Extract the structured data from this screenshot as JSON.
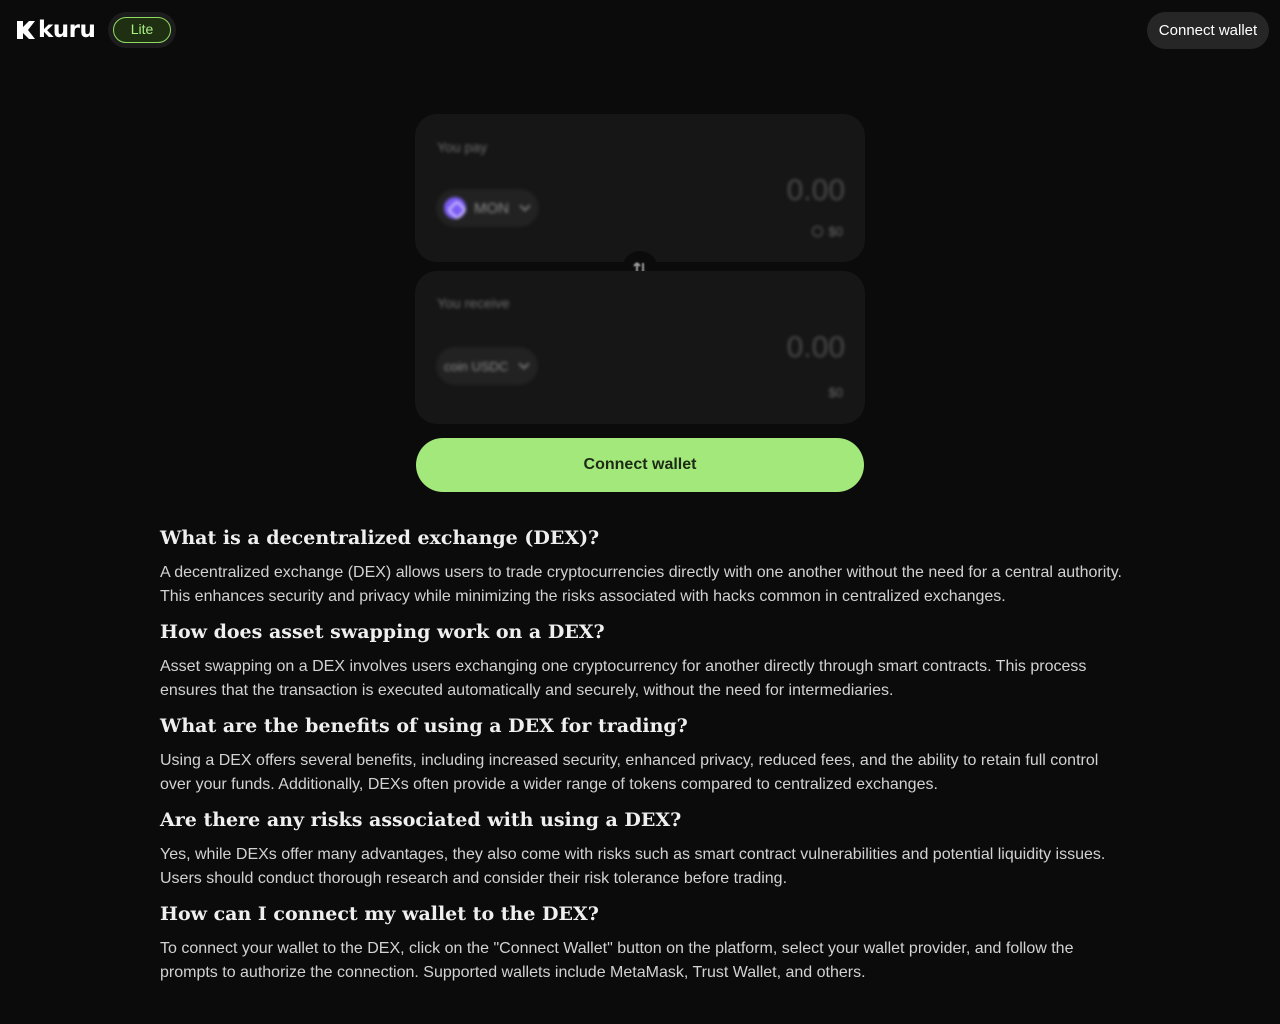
{
  "header": {
    "logo_text": "kuru",
    "badge_label": "Lite",
    "connect_label": "Connect wallet"
  },
  "swap": {
    "pay": {
      "label": "You pay",
      "token": "MON",
      "token_icon": "monad-token-icon",
      "amount_placeholder": "0.00",
      "usd_value": "$0"
    },
    "receive": {
      "label": "You receive",
      "token": "coin USDC",
      "amount_placeholder": "0.00",
      "usd_value": "$0"
    },
    "connect_label": "Connect wallet"
  },
  "faq": [
    {
      "question": "What is a decentralized exchange (DEX)?",
      "answer": "A decentralized exchange (DEX) allows users to trade cryptocurrencies directly with one another without the need for a central authority. This enhances security and privacy while minimizing the risks associated with hacks common in centralized exchanges."
    },
    {
      "question": "How does asset swapping work on a DEX?",
      "answer": "Asset swapping on a DEX involves users exchanging one cryptocurrency for another directly through smart contracts. This process ensures that the transaction is executed automatically and securely, without the need for intermediaries."
    },
    {
      "question": "What are the benefits of using a DEX for trading?",
      "answer": "Using a DEX offers several benefits, including increased security, enhanced privacy, reduced fees, and the ability to retain full control over your funds. Additionally, DEXs often provide a wider range of tokens compared to centralized exchanges."
    },
    {
      "question": "Are there any risks associated with using a DEX?",
      "answer": "Yes, while DEXs offer many advantages, they also come with risks such as smart contract vulnerabilities and potential liquidity issues. Users should conduct thorough research and consider their risk tolerance before trading."
    },
    {
      "question": "How can I connect my wallet to the DEX?",
      "answer": "To connect your wallet to the DEX, click on the \"Connect Wallet\" button on the platform, select your wallet provider, and follow the prompts to authorize the connection. Supported wallets include MetaMask, Trust Wallet, and others."
    }
  ],
  "colors": {
    "background": "#0b0b0b",
    "accent": "#a3e87a",
    "badge_border": "#8fdc63",
    "panel": "#161616"
  }
}
